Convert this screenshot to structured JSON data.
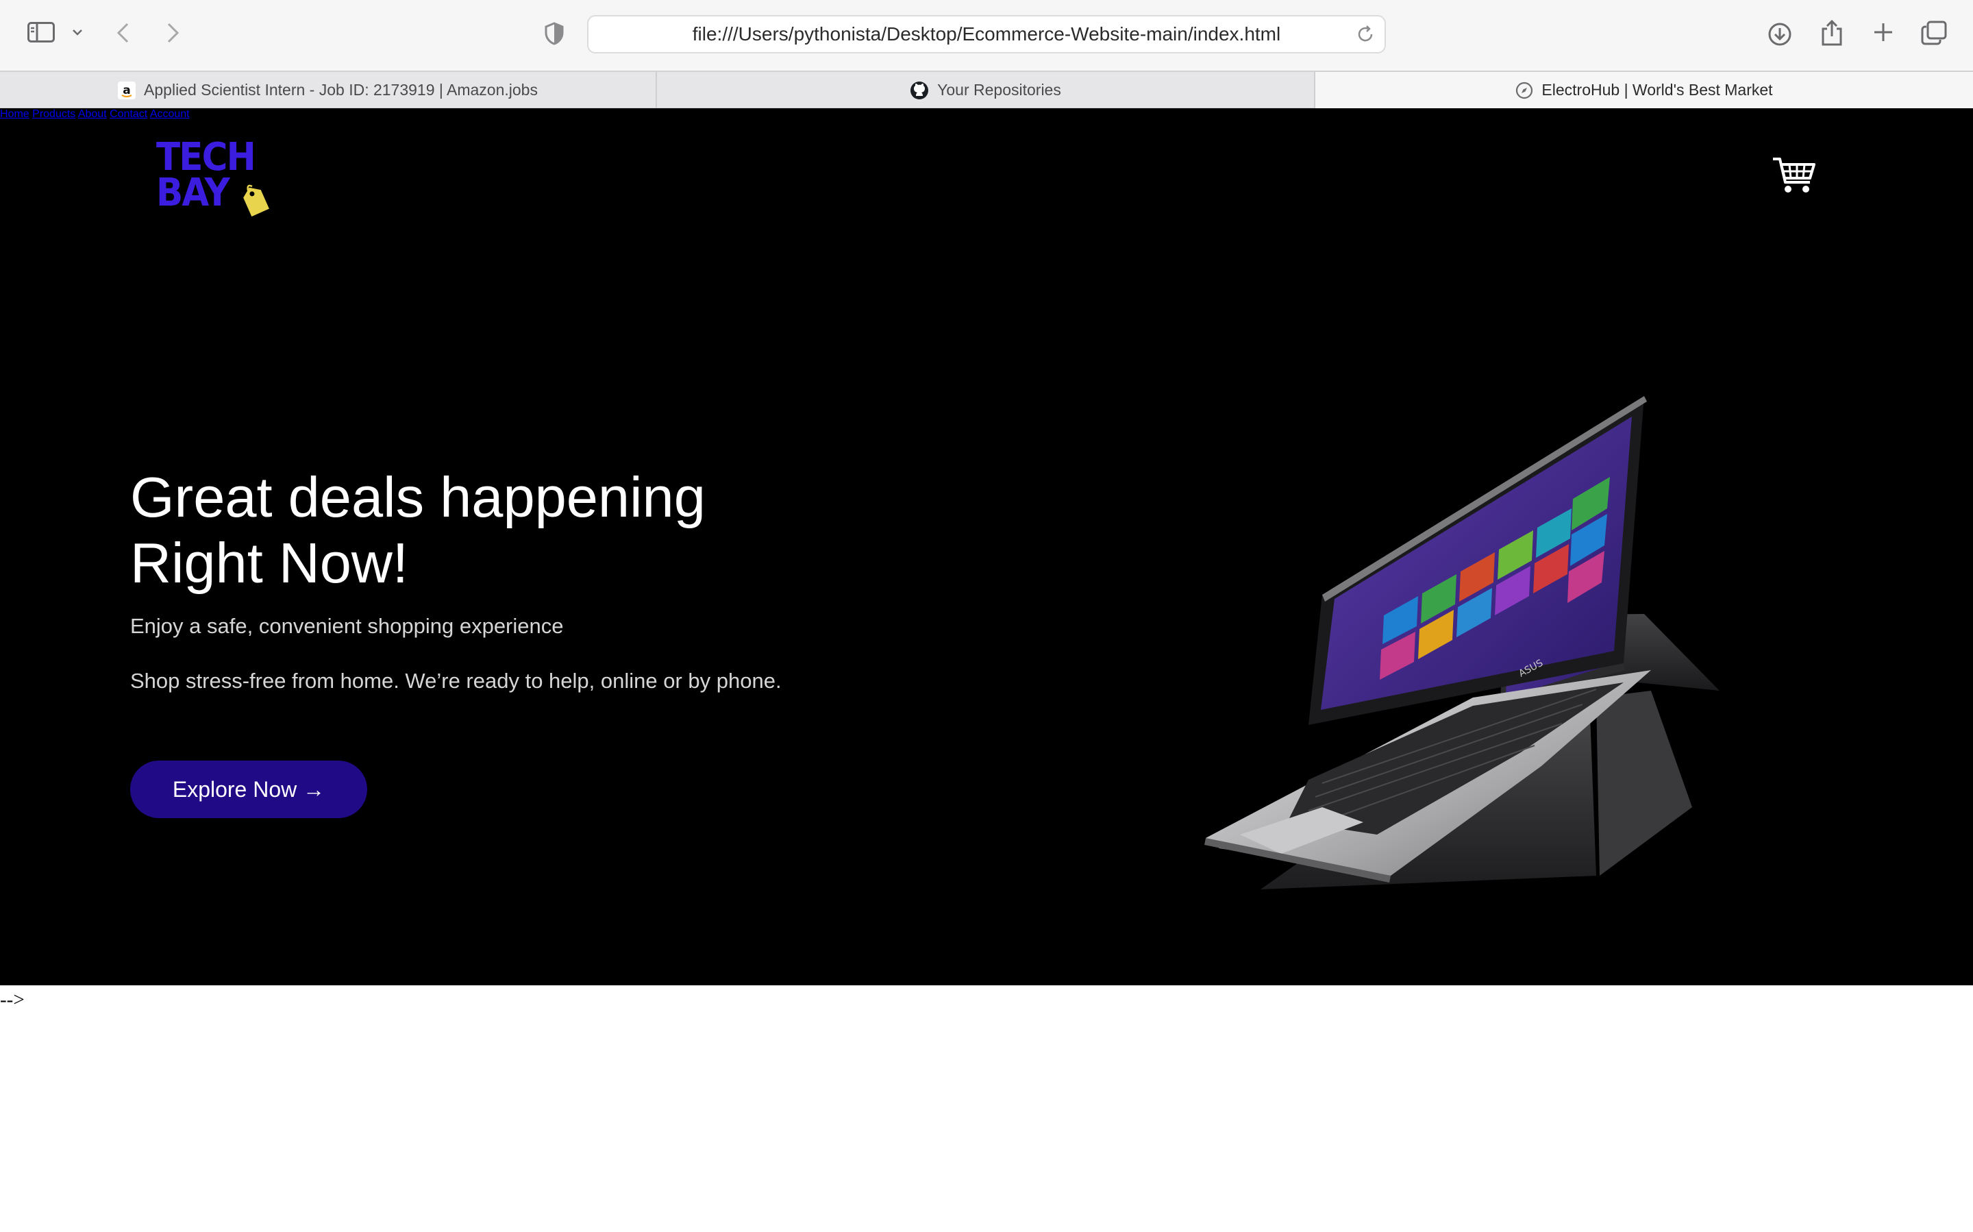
{
  "browser": {
    "url": "file:///Users/pythonista/Desktop/Ecommerce-Website-main/index.html",
    "tabs": [
      {
        "label": "Applied Scientist Intern - Job ID: 2173919 | Amazon.jobs",
        "icon": "amazon-icon",
        "active": false
      },
      {
        "label": "Your Repositories",
        "icon": "github-icon",
        "active": false
      },
      {
        "label": "ElectroHub | World's Best Market",
        "icon": "compass-icon",
        "active": true
      }
    ]
  },
  "site": {
    "logo": {
      "line1": "TECH",
      "line2": "BAY",
      "color": "#3b1de0",
      "tag_color": "#e8d44d"
    },
    "nav": [
      "Home",
      "Products",
      "About",
      "Contact",
      "Account"
    ],
    "cart_icon": "shopping-cart-icon"
  },
  "hero": {
    "headline_line1": "Great deals happening",
    "headline_line2": "Right Now!",
    "subtitle": "Enjoy a safe, convenient shopping experience",
    "description": "Shop stress-free from home. We’re ready to help, online or by phone.",
    "cta_label": "Explore Now →",
    "cta_color": "#200a86",
    "image": "convertible-laptop-image",
    "laptop_brand": "ASUS"
  },
  "stray_text": "-->"
}
